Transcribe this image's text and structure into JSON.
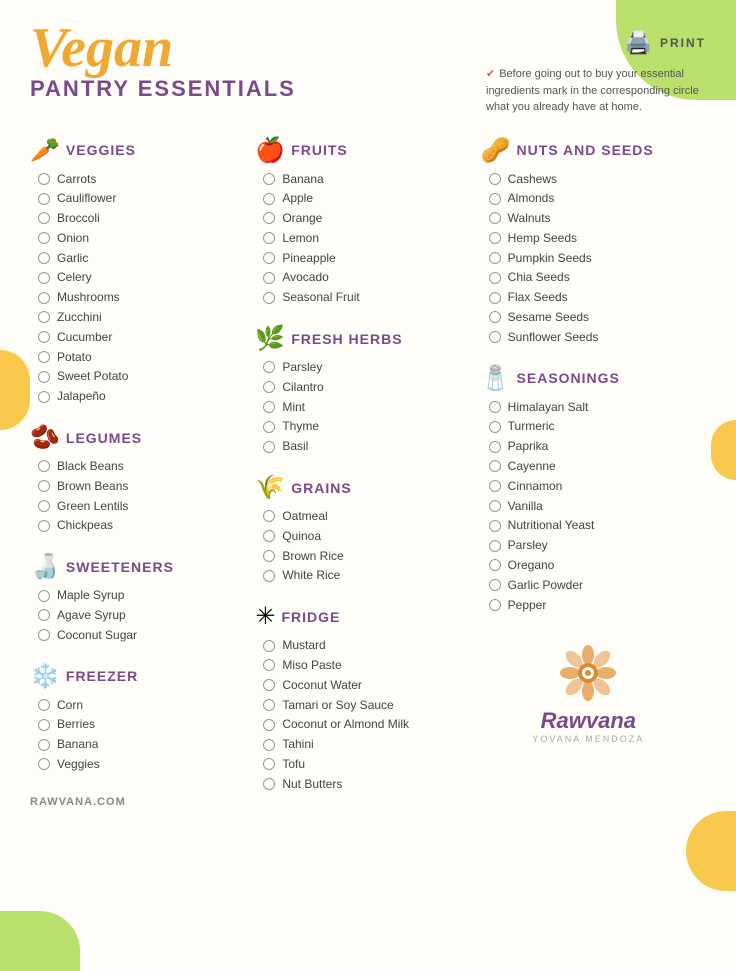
{
  "header": {
    "title_vegan": "Vegan",
    "title_sub": "PANTRY ESSENTIALS",
    "print_label": "PRINT",
    "instruction": "Before going out to buy your essential ingredients mark in the corresponding circle what you already have at home.",
    "website": "RAWVANA.COM"
  },
  "sections": [
    {
      "id": "veggies",
      "title": "VEGGIES",
      "icon": "🥕",
      "items": [
        "Carrots",
        "Cauliflower",
        "Broccoli",
        "Onion",
        "Garlic",
        "Celery",
        "Mushrooms",
        "Zucchini",
        "Cucumber",
        "Potato",
        "Sweet Potato",
        "Jalapeño"
      ]
    },
    {
      "id": "legumes",
      "title": "LEGUMES",
      "icon": "🫘",
      "items": [
        "Black Beans",
        "Brown Beans",
        "Green Lentils",
        "Chickpeas"
      ]
    },
    {
      "id": "sweeteners",
      "title": "SWEETENERS",
      "icon": "🍯",
      "items": [
        "Maple Syrup",
        "Agave Syrup",
        "Coconut Sugar"
      ]
    },
    {
      "id": "freezer",
      "title": "FREEZER",
      "icon": "❄️",
      "items": [
        "Corn",
        "Berries",
        "Banana",
        "Veggies"
      ]
    },
    {
      "id": "fruits",
      "title": "FRUITS",
      "icon": "🍎",
      "items": [
        "Banana",
        "Apple",
        "Orange",
        "Lemon",
        "Pineapple",
        "Avocado",
        "Seasonal Fruit"
      ]
    },
    {
      "id": "fresh-herbs",
      "title": "FRESH HERBS",
      "icon": "🌿",
      "items": [
        "Parsley",
        "Cilantro",
        "Mint",
        "Thyme",
        "Basil"
      ]
    },
    {
      "id": "grains",
      "title": "GRAINS",
      "icon": "🌾",
      "items": [
        "Oatmeal",
        "Quinoa",
        "Brown Rice",
        "White Rice"
      ]
    },
    {
      "id": "fridge",
      "title": "FRIDGE",
      "icon": "❄",
      "items": [
        "Mustard",
        "Miso Paste",
        "Coconut Water",
        "Tamari or Soy Sauce",
        "Coconut or Almond Milk",
        "Tahini",
        "Tofu",
        "Nut Butters"
      ]
    },
    {
      "id": "nuts-seeds",
      "title": "NUTS AND SEEDS",
      "icon": "🥜",
      "items": [
        "Cashews",
        "Almonds",
        "Walnuts",
        "Hemp Seeds",
        "Pumpkin Seeds",
        "Chia Seeds",
        "Flax Seeds",
        "Sesame Seeds",
        "Sunflower Seeds"
      ]
    },
    {
      "id": "seasonings",
      "title": "SEASONINGS",
      "icon": "🧂",
      "items": [
        "Himalayan Salt",
        "Turmeric",
        "Paprika",
        "Cayenne",
        "Cinnamon",
        "Vanilla",
        "Nutritional Yeast",
        "Parsley",
        "Oregano",
        "Garlic Powder",
        "Pepper"
      ]
    }
  ],
  "logo": {
    "name": "Rawvana",
    "sub": "YOVANA MENDOZA"
  }
}
